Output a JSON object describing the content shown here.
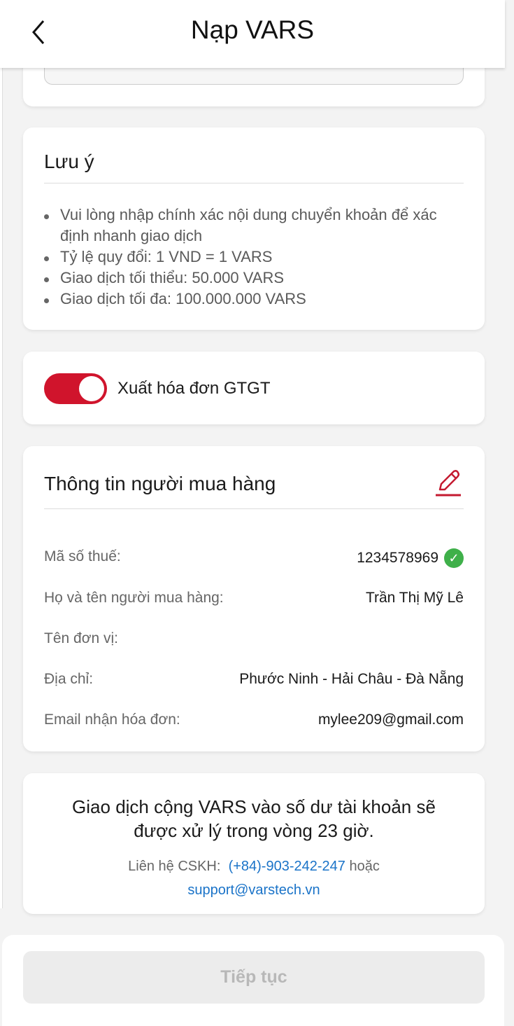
{
  "header": {
    "title": "Nạp VARS",
    "back_icon": "chevron-left-icon"
  },
  "notes": {
    "title": "Lưu ý",
    "items": [
      "Vui lòng nhập chính xác nội dung chuyển khoản để xác định nhanh giao dịch",
      "Tỷ lệ quy đổi: 1 VND = 1 VARS",
      "Giao dịch tối thiểu: 50.000 VARS",
      "Giao dịch tối đa: 100.000.000 VARS"
    ]
  },
  "invoice": {
    "label": "Xuất hóa đơn GTGT",
    "enabled": true,
    "color": "#d0142c"
  },
  "buyer": {
    "title": "Thông tin người mua hàng",
    "edit_icon": "pencil-icon",
    "rows": [
      {
        "label": "Mã số thuế:",
        "value": "1234578969",
        "verified": true
      },
      {
        "label": "Họ và tên người mua hàng:",
        "value": "Trần Thị Mỹ Lê"
      },
      {
        "label": "Tên đơn vị:",
        "value": ""
      },
      {
        "label": "Địa chỉ:",
        "value": "Phước Ninh - Hải Châu - Đà Nẵng"
      },
      {
        "label": "Email nhận hóa đơn:",
        "value": "mylee209@gmail.com"
      }
    ]
  },
  "info": {
    "line1": "Giao dịch cộng VARS vào số dư tài khoản sẽ",
    "line2": "được xử lý trong vòng 23 giờ.",
    "contact_prefix": "Liên hệ CSKH:",
    "phone": "(+84)-903-242-247",
    "or": "hoặc",
    "email": "support@varstech.vn",
    "link_color": "#1a73c8"
  },
  "footer": {
    "continue_label": "Tiếp tục"
  }
}
